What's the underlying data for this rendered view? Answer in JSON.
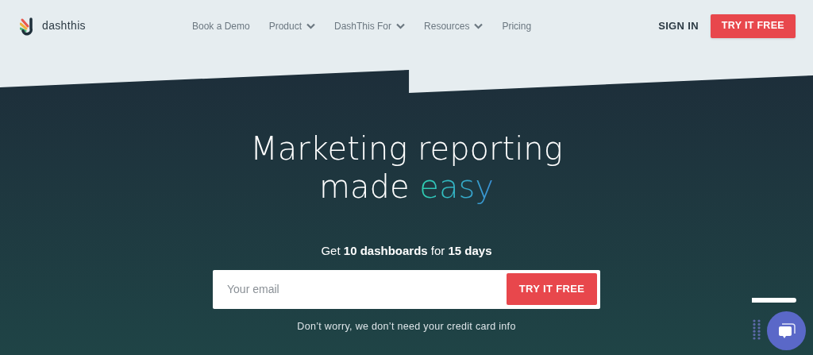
{
  "logo": {
    "text": "dashthis"
  },
  "nav": [
    {
      "label": "Book a Demo",
      "dropdown": false
    },
    {
      "label": "Product",
      "dropdown": true
    },
    {
      "label": "DashThis For",
      "dropdown": true
    },
    {
      "label": "Resources",
      "dropdown": true
    },
    {
      "label": "Pricing",
      "dropdown": false
    }
  ],
  "sign_in": "SIGN IN",
  "header_cta": "TRY IT FREE",
  "hero": {
    "headline_line_1": "Marketing reporting",
    "headline_line_2": "made",
    "headline_highlight": "easy",
    "offer": "Get **10 dashboards** for **15 days**",
    "email": {
      "placeholder": "Your email"
    },
    "cta": "TRY IT FREE",
    "note": "Don’t worry, we don’t need your credit card info"
  }
}
